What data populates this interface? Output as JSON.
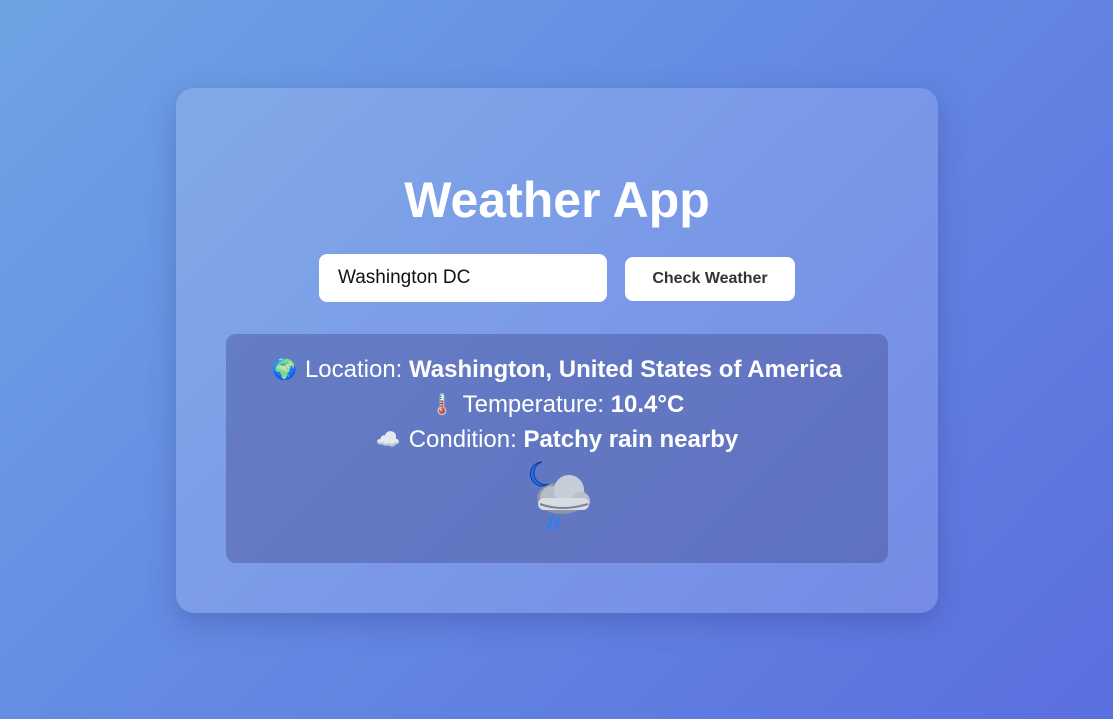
{
  "app": {
    "title": "Weather App"
  },
  "search": {
    "value": "Washington DC",
    "button_label": "Check Weather"
  },
  "result": {
    "location_icon": "🌍",
    "location_label": "Location:",
    "location_value": "Washington, United States of America",
    "temperature_icon": "🌡️",
    "temperature_label": "Temperature:",
    "temperature_value": "10.4°C",
    "condition_icon": "☁️",
    "condition_label": "Condition:",
    "condition_value": "Patchy rain nearby",
    "weather_icon": "patchy-rain-night-icon"
  },
  "colors": {
    "background_start": "#6fa3e3",
    "background_end": "#5b6fdf",
    "text": "#ffffff",
    "button_text": "#333333"
  }
}
